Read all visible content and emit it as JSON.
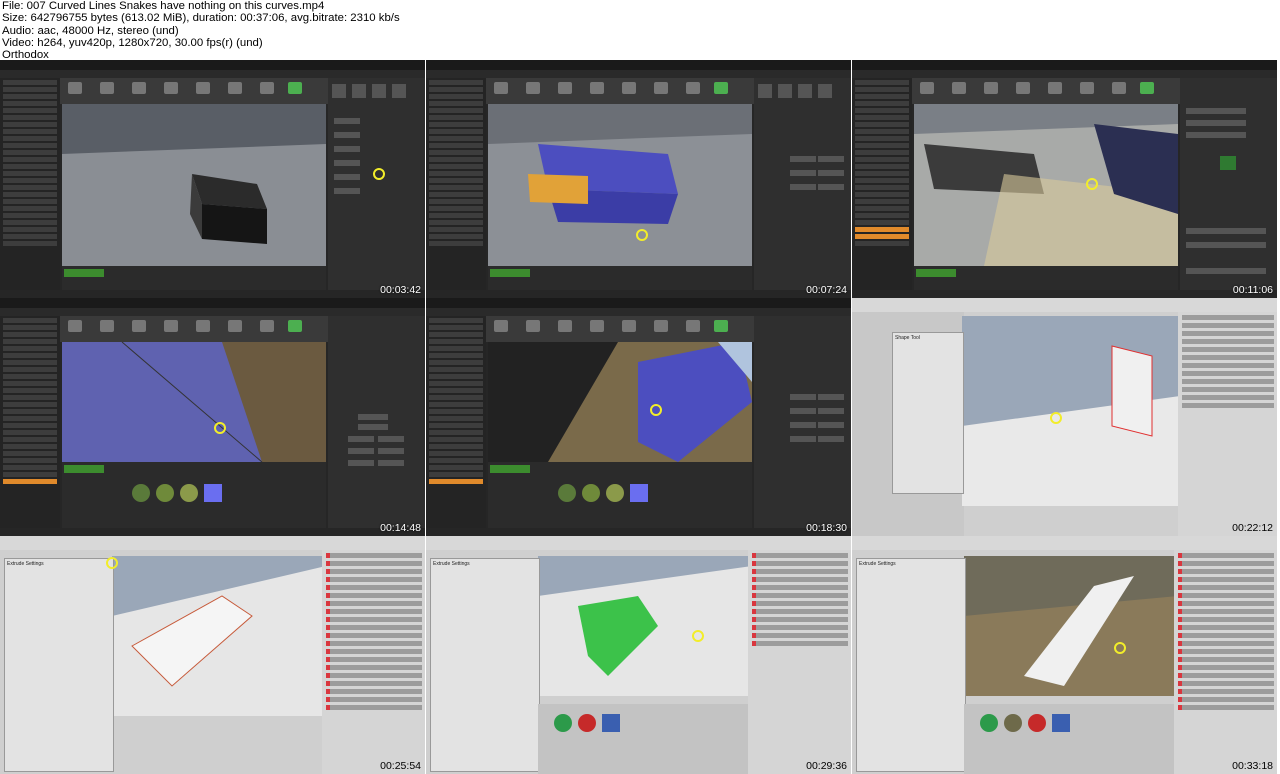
{
  "header": {
    "file": "File: 007 Curved Lines Snakes have nothing on this curves.mp4",
    "size": "Size: 642796755 bytes (613.02 MiB), duration: 00:37:06, avg.bitrate: 2310 kb/s",
    "audio": "Audio: aac, 48000 Hz, stereo (und)",
    "video": "Video: h264, yuv420p, 1280x720, 30.00 fps(r) (und)",
    "author": "Orthodox"
  },
  "thumbs": [
    {
      "time": "00:03:42",
      "kind": "unreal"
    },
    {
      "time": "00:07:24",
      "kind": "unreal"
    },
    {
      "time": "00:11:06",
      "kind": "unreal"
    },
    {
      "time": "00:14:48",
      "kind": "unreal"
    },
    {
      "time": "00:18:30",
      "kind": "unreal"
    },
    {
      "time": "00:22:12",
      "kind": "unity"
    },
    {
      "time": "00:25:54",
      "kind": "unity"
    },
    {
      "time": "00:29:36",
      "kind": "unity"
    },
    {
      "time": "00:33:18",
      "kind": "unity"
    }
  ]
}
